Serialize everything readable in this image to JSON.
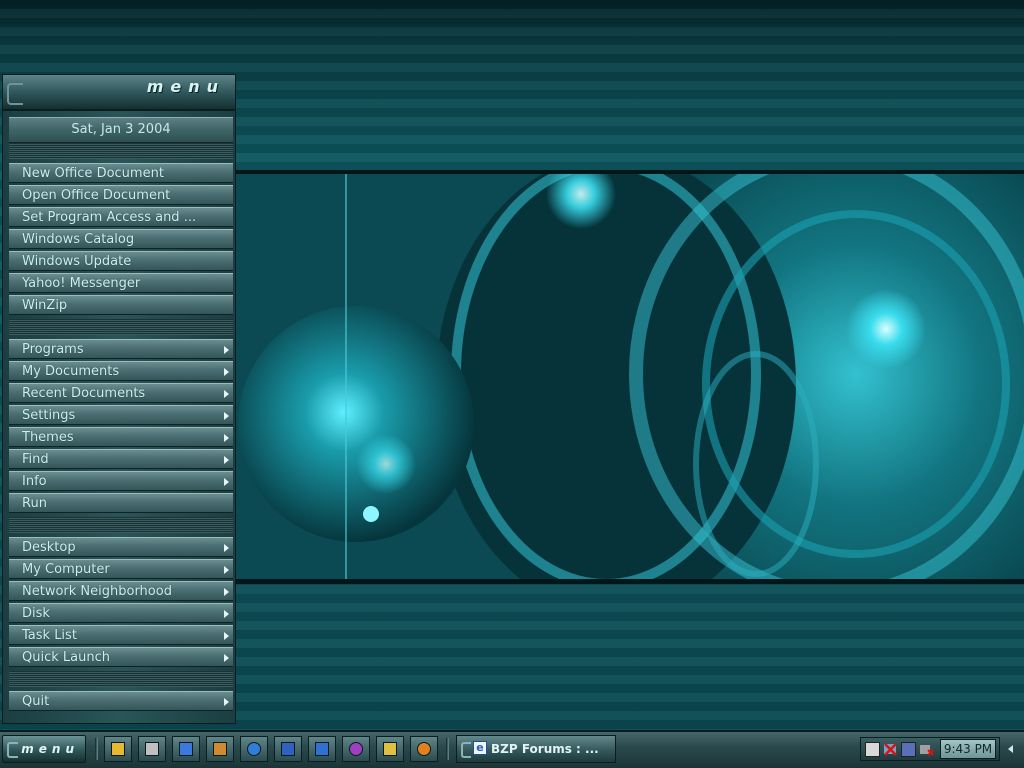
{
  "menu": {
    "logo": "menu",
    "date": "Sat, Jan 3 2004",
    "group1": [
      {
        "label": "New Office Document"
      },
      {
        "label": "Open Office Document"
      },
      {
        "label": "Set Program Access and ..."
      },
      {
        "label": "Windows Catalog"
      },
      {
        "label": "Windows Update"
      },
      {
        "label": "Yahoo! Messenger"
      },
      {
        "label": "WinZip"
      }
    ],
    "group2": [
      {
        "label": "Programs",
        "submenu": true
      },
      {
        "label": "My Documents",
        "submenu": true
      },
      {
        "label": "Recent Documents",
        "submenu": true
      },
      {
        "label": "Settings",
        "submenu": true
      },
      {
        "label": "Themes",
        "submenu": true
      },
      {
        "label": "Find",
        "submenu": true
      },
      {
        "label": "Info",
        "submenu": true
      },
      {
        "label": "Run",
        "submenu": false
      }
    ],
    "group3": [
      {
        "label": "Desktop",
        "submenu": true
      },
      {
        "label": "My Computer",
        "submenu": true
      },
      {
        "label": "Network Neighborhood",
        "submenu": true
      },
      {
        "label": "Disk",
        "submenu": true
      },
      {
        "label": "Task List",
        "submenu": true
      },
      {
        "label": "Quick Launch",
        "submenu": true
      }
    ],
    "quit": {
      "label": "Quit",
      "submenu": true
    }
  },
  "taskbar": {
    "start_label": "menu",
    "quick_launch": [
      {
        "icon": "folder-icon",
        "color": "#e8b830"
      },
      {
        "icon": "scissors-icon",
        "color": "#c0c0c0"
      },
      {
        "icon": "internet-explorer-icon",
        "color": "#3a7ae0"
      },
      {
        "icon": "tools-icon",
        "color": "#d08a30"
      },
      {
        "icon": "refresh-icon",
        "color": "#2f7fd6"
      },
      {
        "icon": "windows-icon",
        "color": "#3060c0"
      },
      {
        "icon": "settings-window-icon",
        "color": "#3070d0"
      },
      {
        "icon": "palette-icon",
        "color": "#a040c0"
      },
      {
        "icon": "pencil-icon",
        "color": "#e0c040"
      },
      {
        "icon": "media-player-icon",
        "color": "#e08020"
      }
    ],
    "task": {
      "label": "BZP Forums : ..."
    },
    "tray_icons": [
      "monitor-icon",
      "network-disconnected-icon",
      "computer-icon",
      "security-icon"
    ],
    "clock": "9:43 PM"
  }
}
